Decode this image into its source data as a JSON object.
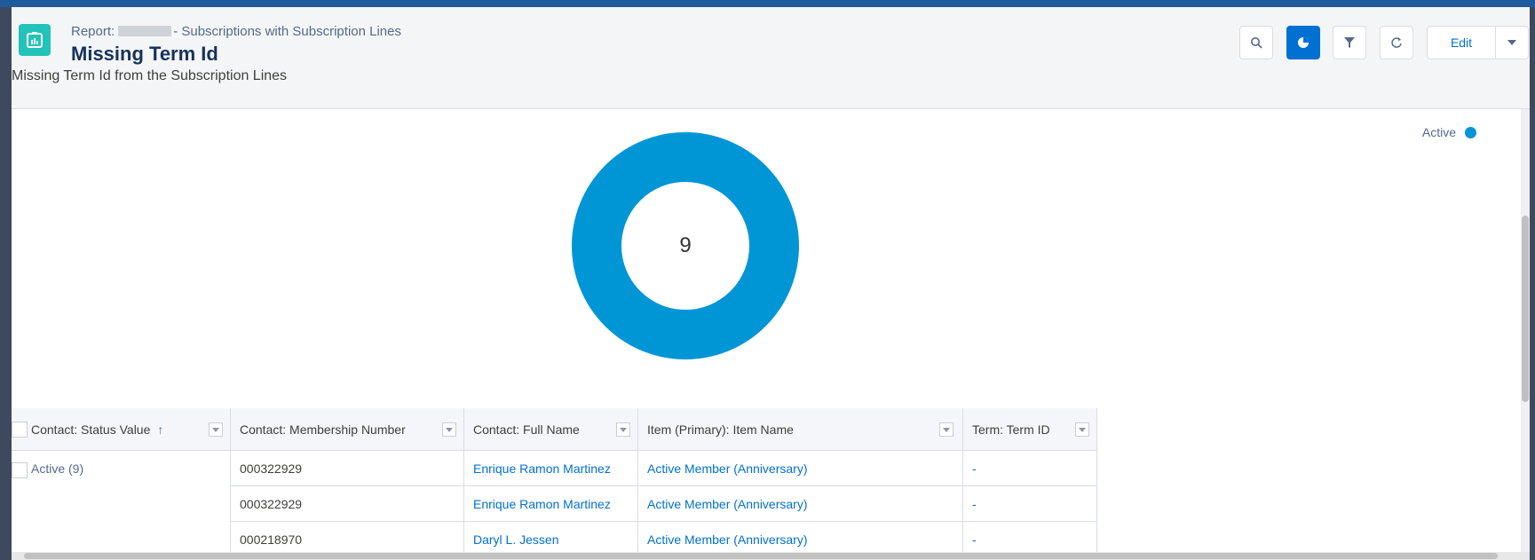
{
  "header": {
    "breadcrumb_prefix": "Report:",
    "breadcrumb_suffix": "- Subscriptions with Subscription Lines",
    "title": "Missing Term Id",
    "description": "Missing Term Id from the Subscription Lines",
    "edit_label": "Edit"
  },
  "chart_data": {
    "type": "pie",
    "center_label": "9",
    "slices": [
      {
        "label": "Active",
        "value": 9
      }
    ],
    "legend": [
      "Active"
    ],
    "legend_position": "top-right",
    "color": "#0096d6"
  },
  "table": {
    "headers": [
      "Contact: Status Value",
      "Contact: Membership Number",
      "Contact: Full Name",
      "Item (Primary): Item Name",
      "Term: Term ID"
    ],
    "sort_indicator": "↑",
    "group_label": "Active (9)",
    "rows": [
      {
        "membership": "000322929",
        "name": "Enrique Ramon Martinez",
        "item": "Active Member (Anniversary)",
        "term": "-"
      },
      {
        "membership": "000322929",
        "name": "Enrique Ramon Martinez",
        "item": "Active Member (Anniversary)",
        "term": "-"
      },
      {
        "membership": "000218970",
        "name": "Daryl L. Jessen",
        "item": "Active Member (Anniversary)",
        "term": "-"
      }
    ]
  },
  "colors": {
    "accent": "#0070d2",
    "report_icon": "#22c3b8",
    "donut": "#0096d6"
  },
  "icons": [
    "report-icon",
    "search-icon",
    "chart-toggle-icon",
    "filter-icon",
    "refresh-icon",
    "chevron-down-icon"
  ]
}
